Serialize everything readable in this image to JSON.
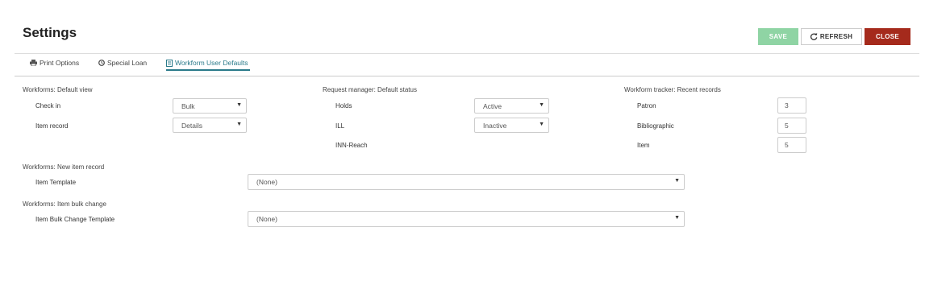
{
  "header": {
    "title": "Settings"
  },
  "buttons": {
    "save": "SAVE",
    "refresh": "REFRESH",
    "close": "CLOSE"
  },
  "tabs": [
    {
      "label": "Print Options",
      "icon": "print-icon"
    },
    {
      "label": "Special Loan",
      "icon": "clock-icon"
    },
    {
      "label": "Workform User Defaults",
      "icon": "form-icon",
      "active": true
    }
  ],
  "workforms_default_view": {
    "heading": "Workforms: Default view",
    "check_in": {
      "label": "Check in",
      "value": "Bulk"
    },
    "item_record": {
      "label": "Item record",
      "value": "Details"
    }
  },
  "request_manager": {
    "heading": "Request manager: Default status",
    "holds": {
      "label": "Holds",
      "value": "Active"
    },
    "ill": {
      "label": "ILL",
      "value": "Inactive"
    },
    "inn_reach": {
      "label": "INN-Reach"
    }
  },
  "workform_tracker": {
    "heading": "Workform tracker: Recent records",
    "patron": {
      "label": "Patron",
      "value": "3"
    },
    "bibliographic": {
      "label": "Bibliographic",
      "value": "5"
    },
    "item": {
      "label": "Item",
      "value": "5"
    }
  },
  "new_item_record": {
    "heading": "Workforms: New item record",
    "template": {
      "label": "Item Template",
      "value": "(None)"
    }
  },
  "item_bulk_change": {
    "heading": "Workforms: Item bulk change",
    "template": {
      "label": "Item Bulk Change Template",
      "value": "(None)"
    }
  },
  "colors": {
    "save": "#8fd4a4",
    "close": "#a52a1c",
    "accent": "#2a7a8a"
  }
}
